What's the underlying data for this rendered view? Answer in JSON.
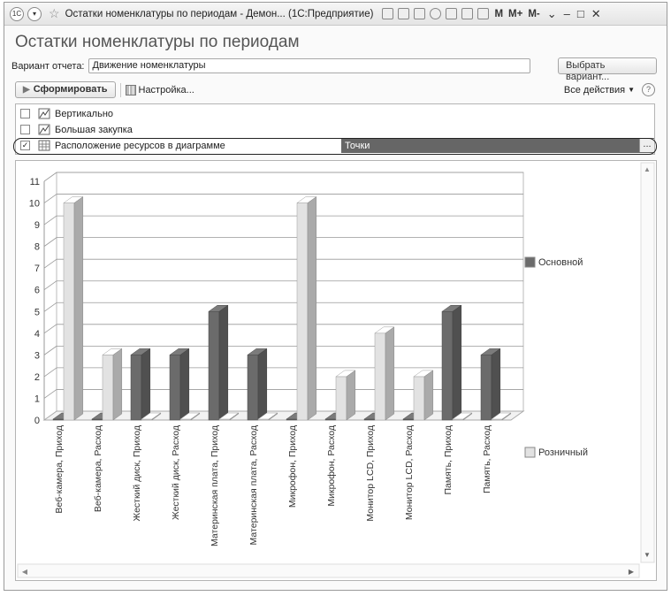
{
  "window": {
    "title": "Остатки номенклатуры по периодам - Демон...  (1С:Предприятие)",
    "memory_buttons": [
      "M",
      "M+",
      "M-"
    ]
  },
  "header": {
    "title": "Остатки номенклатуры по периодам"
  },
  "variant": {
    "label": "Вариант отчета:",
    "value": "Движение номенклатуры",
    "select_button": "Выбрать вариант..."
  },
  "toolbar": {
    "generate_label": "Сформировать",
    "settings_label": "Настройка...",
    "all_actions_label": "Все действия",
    "help_label": "?"
  },
  "settings": [
    {
      "label": "Вертикально",
      "checked": false,
      "value": ""
    },
    {
      "label": "Большая закупка",
      "checked": false,
      "value": ""
    },
    {
      "label": "Расположение ресурсов в диаграмме",
      "checked": true,
      "value": "Точки"
    }
  ],
  "chart_data": {
    "type": "bar",
    "categories": [
      "Веб-камера, Приход",
      "Веб-камера, Расход",
      "Жесткий диск, Приход",
      "Жесткий диск, Расход",
      "Материнская плата, Приход",
      "Материнская плата, Расход",
      "Микрофон, Приход",
      "Микрофон, Расход",
      "Монитор LCD, Приход",
      "Монитор LCD, Расход",
      "Память, Приход",
      "Память, Расход"
    ],
    "series": [
      {
        "name": "Основной",
        "values": [
          0,
          0,
          3,
          3,
          5,
          3,
          0,
          0,
          0,
          0,
          5,
          3
        ],
        "color": "#6b6b6b"
      },
      {
        "name": "Розничный",
        "values": [
          10,
          3,
          0,
          0,
          0,
          0,
          10,
          2,
          4,
          2,
          0,
          0
        ],
        "color": "#e2e2e2"
      }
    ],
    "yticks": [
      "0",
      "1",
      "2",
      "3",
      "4",
      "5",
      "6",
      "7",
      "8",
      "9",
      "10",
      "11"
    ],
    "ylim": [
      0,
      11
    ],
    "grid": true,
    "legend_position": "right"
  }
}
